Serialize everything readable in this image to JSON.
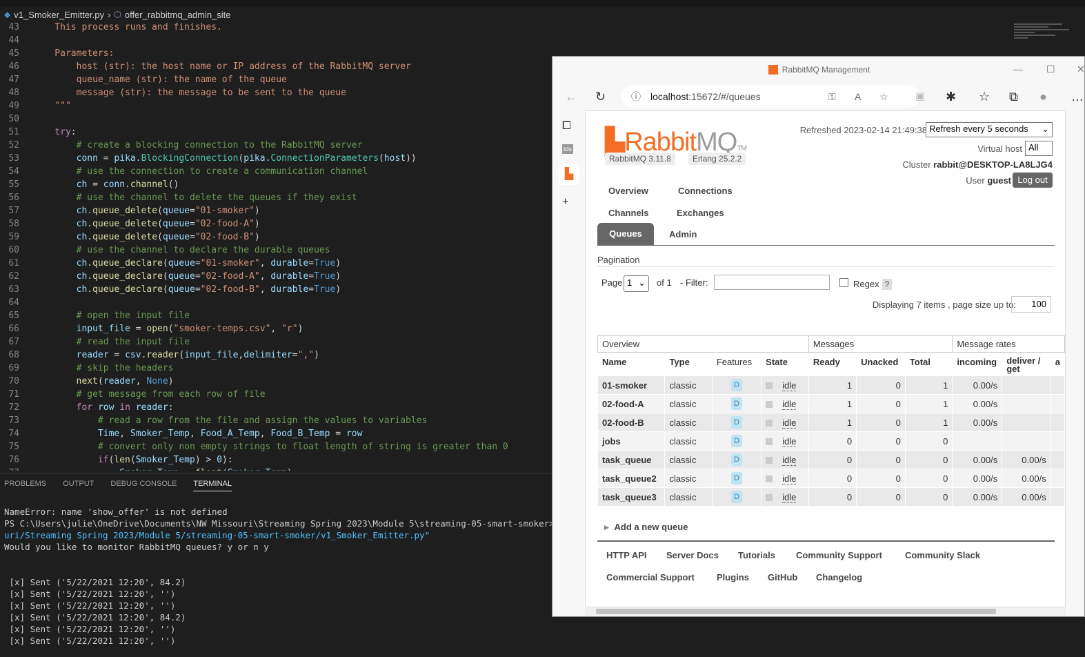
{
  "vscode": {
    "breadcrumb_file": "v1_Smoker_Emitter.py",
    "breadcrumb_symbol": "offer_rabbitmq_admin_site",
    "code_lines": [
      {
        "n": "43",
        "t": "    This process runs and finishes."
      },
      {
        "n": "44",
        "t": ""
      },
      {
        "n": "45",
        "t": "    Parameters:"
      },
      {
        "n": "46",
        "t": "        host (str): the host name or IP address of the RabbitMQ server"
      },
      {
        "n": "47",
        "t": "        queue_name (str): the name of the queue"
      },
      {
        "n": "48",
        "t": "        message (str): the message to be sent to the queue"
      },
      {
        "n": "49",
        "t": "    \"\"\""
      },
      {
        "n": "50",
        "t": ""
      },
      {
        "n": "51",
        "t": "    try:"
      },
      {
        "n": "52",
        "t": "        # create a blocking connection to the RabbitMQ server"
      },
      {
        "n": "53",
        "t": "        conn = pika.BlockingConnection(pika.ConnectionParameters(host))"
      },
      {
        "n": "54",
        "t": "        # use the connection to create a communication channel"
      },
      {
        "n": "55",
        "t": "        ch = conn.channel()"
      },
      {
        "n": "56",
        "t": "        # use the channel to delete the queues if they exist"
      },
      {
        "n": "57",
        "t": "        ch.queue_delete(queue=\"01-smoker\")"
      },
      {
        "n": "58",
        "t": "        ch.queue_delete(queue=\"02-food-A\")"
      },
      {
        "n": "59",
        "t": "        ch.queue_delete(queue=\"02-food-B\")"
      },
      {
        "n": "60",
        "t": "        # use the channel to declare the durable queues"
      },
      {
        "n": "61",
        "t": "        ch.queue_declare(queue=\"01-smoker\", durable=True)"
      },
      {
        "n": "62",
        "t": "        ch.queue_declare(queue=\"02-food-A\", durable=True)"
      },
      {
        "n": "63",
        "t": "        ch.queue_declare(queue=\"02-food-B\", durable=True)"
      },
      {
        "n": "64",
        "t": ""
      },
      {
        "n": "65",
        "t": "        # open the input file"
      },
      {
        "n": "66",
        "t": "        input_file = open(\"smoker-temps.csv\", \"r\")"
      },
      {
        "n": "67",
        "t": "        # read the input file"
      },
      {
        "n": "68",
        "t": "        reader = csv.reader(input_file,delimiter=\",\")"
      },
      {
        "n": "69",
        "t": "        # skip the headers"
      },
      {
        "n": "70",
        "t": "        next(reader, None)"
      },
      {
        "n": "71",
        "t": "        # get message from each row of file"
      },
      {
        "n": "72",
        "t": "        for row in reader:"
      },
      {
        "n": "73",
        "t": "            # read a row from the file and assign the values to variables"
      },
      {
        "n": "74",
        "t": "            Time, Smoker_Temp, Food_A_Temp, Food_B_Temp = row"
      },
      {
        "n": "75",
        "t": "            # convert only non empty strings to float length of string is greater than 0"
      },
      {
        "n": "76",
        "t": "            if(len(Smoker_Temp) > 0):"
      },
      {
        "n": "77",
        "t": "                Smoker_Temp = float(Smoker_Temp)"
      }
    ],
    "panel_tabs": [
      "PROBLEMS",
      "OUTPUT",
      "DEBUG CONSOLE",
      "TERMINAL"
    ],
    "terminal_lines": [
      "NameError: name 'show_offer' is not defined",
      "PS C:\\Users\\julie\\OneDrive\\Documents\\NW Missouri\\Streaming Spring 2023\\Module 5\\streaming-05-smart-smoker> & C:/Us",
      "uri/Streaming Spring 2023/Module 5/streaming-05-smart-smoker/v1_Smoker_Emitter.py\"",
      "Would you like to monitor RabbitMQ queues? y or n y",
      "",
      "",
      " [x] Sent ('5/22/2021 12:20', 84.2)",
      " [x] Sent ('5/22/2021 12:20', '')",
      " [x] Sent ('5/22/2021 12:20', '')",
      " [x] Sent ('5/22/2021 12:20', 84.2)",
      " [x] Sent ('5/22/2021 12:20', '')",
      " [x] Sent ('5/22/2021 12:20', '')"
    ]
  },
  "browser": {
    "window_title": "RabbitMQ Management",
    "url_host": "localhost",
    "url_rest": ":15672/#/queues",
    "side_label": "tds"
  },
  "rmq": {
    "logo_rabbit": "Rabbit",
    "logo_mq": "MQ",
    "logo_tm": "TM",
    "version": "RabbitMQ 3.11.8",
    "erlang": "Erlang 25.2.2",
    "refreshed": "Refreshed 2023-02-14 21:49:38",
    "refresh_option": "Refresh every 5 seconds",
    "virtual_host_label": "Virtual host",
    "virtual_host_value": "All",
    "cluster_label": "Cluster",
    "cluster_name": "rabbit@DESKTOP-LA8LJG4",
    "user_label": "User",
    "user_name": "guest",
    "logout": "Log out",
    "tabs": {
      "overview": "Overview",
      "connections": "Connections",
      "channels": "Channels",
      "exchanges": "Exchanges",
      "queues": "Queues",
      "admin": "Admin"
    },
    "pagination_label": "Pagination",
    "page_label": "Page",
    "page_value": "1",
    "of_label": "of 1",
    "filter_label": "- Filter:",
    "regex_label": "Regex",
    "help": "?",
    "displaying": "Displaying 7 items , page size up to:",
    "page_size": "100",
    "table_groups": [
      "Overview",
      "Messages",
      "Message rates"
    ],
    "columns": [
      "Name",
      "Type",
      "Features",
      "State",
      "Ready",
      "Unacked",
      "Total",
      "incoming",
      "deliver / get",
      "a"
    ],
    "queues": [
      {
        "name": "01-smoker",
        "type": "classic",
        "feature": "D",
        "state": "idle",
        "ready": "1",
        "unacked": "0",
        "total": "1",
        "incoming": "0.00/s",
        "deliver": ""
      },
      {
        "name": "02-food-A",
        "type": "classic",
        "feature": "D",
        "state": "idle",
        "ready": "1",
        "unacked": "0",
        "total": "1",
        "incoming": "0.00/s",
        "deliver": ""
      },
      {
        "name": "02-food-B",
        "type": "classic",
        "feature": "D",
        "state": "idle",
        "ready": "1",
        "unacked": "0",
        "total": "1",
        "incoming": "0.00/s",
        "deliver": ""
      },
      {
        "name": "jobs",
        "type": "classic",
        "feature": "D",
        "state": "idle",
        "ready": "0",
        "unacked": "0",
        "total": "0",
        "incoming": "",
        "deliver": ""
      },
      {
        "name": "task_queue",
        "type": "classic",
        "feature": "D",
        "state": "idle",
        "ready": "0",
        "unacked": "0",
        "total": "0",
        "incoming": "0.00/s",
        "deliver": "0.00/s"
      },
      {
        "name": "task_queue2",
        "type": "classic",
        "feature": "D",
        "state": "idle",
        "ready": "0",
        "unacked": "0",
        "total": "0",
        "incoming": "0.00/s",
        "deliver": "0.00/s"
      },
      {
        "name": "task_queue3",
        "type": "classic",
        "feature": "D",
        "state": "idle",
        "ready": "0",
        "unacked": "0",
        "total": "0",
        "incoming": "0.00/s",
        "deliver": "0.00/s"
      }
    ],
    "add_queue": "Add a new queue",
    "footer": {
      "http_api": "HTTP API",
      "server_docs": "Server Docs",
      "tutorials": "Tutorials",
      "community_support": "Community Support",
      "community_slack": "Community Slack",
      "commercial_support": "Commercial Support",
      "plugins": "Plugins",
      "github": "GitHub",
      "changelog": "Changelog"
    }
  }
}
